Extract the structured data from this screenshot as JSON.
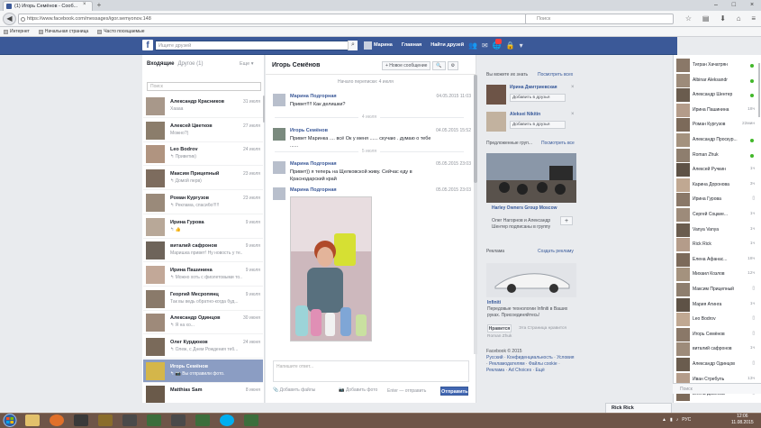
{
  "browser": {
    "tab_title": "(1) Игорь Семёнов - Сооб...",
    "tab_close": "×",
    "new_tab": "+",
    "url": "https://www.facebook.com/messages/igor.semyonov.148",
    "search_placeholder": "Поиск",
    "window_controls": [
      "–",
      "□",
      "×"
    ],
    "toolbar_icons": [
      "star-icon",
      "clipboard-icon",
      "download-icon",
      "home-icon",
      "menu-icon"
    ],
    "bookmarks": [
      "Интернет",
      "Начальная страница",
      "Часто посещаемые"
    ]
  },
  "fb_header": {
    "logo": "f",
    "search_placeholder": "Ищите друзей",
    "nav": [
      "Марина",
      "Главная",
      "Найти друзей"
    ],
    "jewels": [
      "friends-icon",
      "messages-icon",
      "notifications-icon",
      "privacy-icon",
      "settings-icon"
    ]
  },
  "inbox": {
    "tab_inbox": "Входящие",
    "tab_other": "Другое (1)",
    "more": "Еще ▾",
    "search_placeholder": "Поиск",
    "conversations": [
      {
        "name": "Александр Красников",
        "snippet": "Хаааа",
        "date": "31 июля"
      },
      {
        "name": "Алексей Цветков",
        "snippet": "Можно?)",
        "date": "27 июля"
      },
      {
        "name": "Leo Bodrov",
        "snippet": "↰ Приветик)",
        "date": "24 июля"
      },
      {
        "name": "Максим Прицепный",
        "snippet": "↰ Домой перв)",
        "date": "23 июля"
      },
      {
        "name": "Роман Кургузов",
        "snippet": "↰ Реклама, спасибо!!!!!",
        "date": "23 июля"
      },
      {
        "name": "Ирина Гурова",
        "snippet": "↰ 👍",
        "date": "9 июля"
      },
      {
        "name": "виталий сафронов",
        "snippet": "Маришка привет! Ну новость у те...",
        "date": "9 июля"
      },
      {
        "name": "Ирина Пашинина",
        "snippet": "↰ Можно хоть с фиолетовыми то...",
        "date": "9 июля"
      },
      {
        "name": "Георгий Месропянц",
        "snippet": "Так вы ведь обратно-когда буд...",
        "date": "9 июля"
      },
      {
        "name": "Александр Одинцов",
        "snippet": "↰ Я на хо...",
        "date": "30 июня"
      },
      {
        "name": "Олег Курдюков",
        "snippet": "↰ Олеж, с Днем Рождения теб...",
        "date": "24 июня"
      },
      {
        "name": "Игорь Семёнов",
        "snippet": "↰ 📷 Вы отправили фото.",
        "date": ""
      },
      {
        "name": "Matthias Sam",
        "snippet": "",
        "date": "8 июня"
      }
    ]
  },
  "thread": {
    "title": "Игорь Семёнов",
    "new_message_btn": "+ Новое сообщение",
    "search_icon_btn": "🔍",
    "gear_btn": "⚙",
    "chevron_btn": "▾",
    "earlier": "Начало переписки: 4 июля",
    "separators": [
      "4 июля",
      "5 июля"
    ],
    "messages": [
      {
        "sender": "Марина Подгорная",
        "text": "Привет!!!! Как делишки?",
        "time": "04.05.2015 11:03"
      },
      {
        "sender": "Игорь Семёнов",
        "text": "Привет Маринка .... всё Ок у меня ...... скучаю . думаю о тебе ......",
        "time": "04.05.2015 15:52"
      },
      {
        "sender": "Марина Подгорная",
        "text": "Привет)) я теперь на Щелковской живу. Сейчас еду в Краснодарский край",
        "time": "05.05.2015 23:03"
      },
      {
        "sender": "Марина Подгорная",
        "text": "",
        "time": "05.05.2015 23:03"
      }
    ],
    "composer_placeholder": "Напишите ответ...",
    "attach_files": "Добавить файлы",
    "attach_photo": "Добавить фото",
    "enter_label": "Enter — отправить",
    "send": "Отправить"
  },
  "right": {
    "pymk_head": "Вы можете их знать",
    "pymk_link": "Посмотреть всех",
    "people": [
      {
        "name": "Ирина Дмитриевская",
        "button": "Добавить в друзья"
      },
      {
        "name": "Aleksei Nikitin",
        "button": "Добавить в друзья"
      }
    ],
    "groups_head": "Предложенные груп...",
    "groups_link": "Посмотреть все",
    "group_name": "Harley Owners Group Moscow",
    "group_sub": "Олег Нагорнов и Александр Шентер подписаны в группу",
    "group_join": "+",
    "ads_head": "Реклама",
    "ads_link": "Создать рекламу",
    "ad_title": "Infiniti",
    "ad_text": "Передовые технологии Infiniti в Ваших руках. Присоединяйтесь!",
    "ad_like": "Нравится",
    "ad_likes": "Эта Страница нравится",
    "ad_who": "Roman Zhuk",
    "footer_copy": "Facebook © 2015",
    "footer_links": [
      "Русский",
      "Конфиденциальность",
      "Условия",
      "Рекламодателям",
      "Файлы cookie",
      "Реклама",
      "Ad Choices",
      "Ещё"
    ]
  },
  "chat": {
    "contacts": [
      {
        "name": "Тигран Хачатрян",
        "status": "online"
      },
      {
        "name": "Albinar Aleksandr",
        "status": "online"
      },
      {
        "name": "Александр Шентер",
        "status": "online"
      },
      {
        "name": "Ирина Пашинина",
        "status": "18ч"
      },
      {
        "name": "Роман Кургузов",
        "status": "22мин"
      },
      {
        "name": "Александр Проскур...",
        "status": "online"
      },
      {
        "name": "Roman Zhuk",
        "status": "online"
      },
      {
        "name": "Алексей Ручкин",
        "status": "1ч"
      },
      {
        "name": "Карина Доронова",
        "status": "3ч"
      },
      {
        "name": "Ирина Гурова",
        "status": ""
      },
      {
        "name": "Сергей Соцкие...",
        "status": "1ч"
      },
      {
        "name": "Vanya Vanya",
        "status": "1ч"
      },
      {
        "name": "Rick Rick",
        "status": "1ч"
      },
      {
        "name": "Елена Афанас...",
        "status": "18ч"
      },
      {
        "name": "Михаил Козлов",
        "status": "12ч"
      },
      {
        "name": "Максим Прицепный",
        "status": ""
      },
      {
        "name": "Мария Атинга",
        "status": "1ч"
      },
      {
        "name": "Leo Bodrov",
        "status": ""
      },
      {
        "name": "Игорь Семёнов",
        "status": ""
      },
      {
        "name": "виталий сафронов",
        "status": "1ч"
      },
      {
        "name": "Александр Одинцов",
        "status": ""
      },
      {
        "name": "Иван Стребуль",
        "status": "13ч"
      },
      {
        "name": "Елена Дивяева",
        "status": ""
      }
    ],
    "search_placeholder": "Поиск",
    "open_tab": "Rick Rick"
  },
  "taskbar": {
    "tray_lang": "РУС",
    "time": "12:06",
    "date": "11.08.2015"
  }
}
